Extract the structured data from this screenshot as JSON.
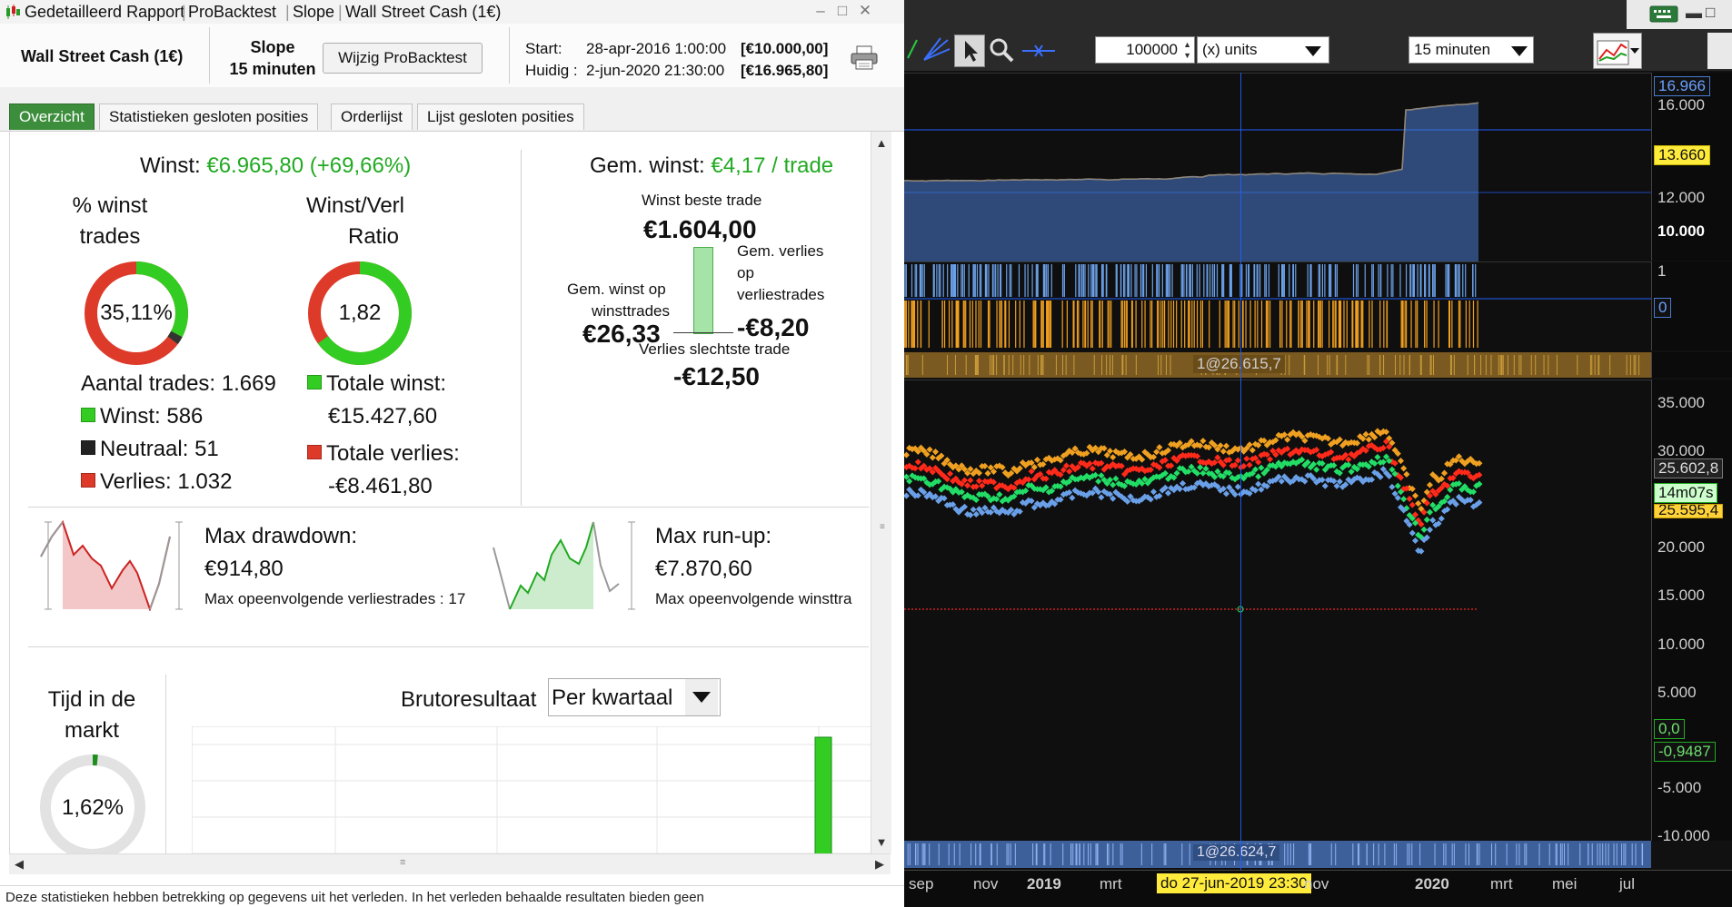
{
  "report": {
    "titlebar": {
      "items": [
        "Gedetailleerd Rapport",
        "ProBacktest",
        "Slope",
        "Wall Street Cash (1€)"
      ],
      "minimize": "–",
      "maximize": "□",
      "close": "✕"
    },
    "header": {
      "instrument": "Wall Street Cash (1€)",
      "strategy_name": "Slope",
      "timeframe": "15 minuten",
      "modify_button": "Wijzig ProBacktest",
      "start_label": "Start:",
      "start_date": "28-apr-2016 1:00:00",
      "start_value": "[€10.000,00]",
      "current_label": "Huidig :",
      "current_date": "2-jun-2020 21:30:00",
      "current_value": "[€16.965,80]"
    },
    "tabs": [
      "Overzicht",
      "Statistieken gesloten posities",
      "Orderlijst",
      "Lijst gesloten posities"
    ],
    "summary": {
      "profit_label": "Winst:",
      "profit_value": "€6.965,80 (+69,66%)",
      "pct_win_title_1": "% winst",
      "pct_win_title_2": "trades",
      "pct_win_value": "35,11%",
      "pct_win_fraction": 0.3511,
      "ratio_title_1": "Winst/Verl",
      "ratio_title_2": "Ratio",
      "ratio_value": "1,82",
      "num_trades_label": "Aantal trades:",
      "num_trades_value": "1.669",
      "win_label": "Winst:",
      "win_count": "586",
      "neutral_label": "Neutraal:",
      "neutral_count": "51",
      "loss_label": "Verlies:",
      "loss_count": "1.032",
      "total_win_label": "Totale winst:",
      "total_win_value": "€15.427,60",
      "total_loss_label": "Totale verlies:",
      "total_loss_value": "-€8.461,80"
    },
    "avg": {
      "label": "Gem. winst:",
      "value": "€4,17 / trade",
      "best_label": "Winst beste trade",
      "best_value": "€1.604,00",
      "avg_win_label_1": "Gem. winst op",
      "avg_win_label_2": "winsttrades",
      "avg_win_value": "€26,33",
      "avg_loss_label_1": "Gem. verlies",
      "avg_loss_label_2": "op",
      "avg_loss_label_3": "verliestrades",
      "avg_loss_value": "-€8,20",
      "worst_label": "Verlies slechtste trade",
      "worst_value": "-€12,50"
    },
    "drawdown": {
      "label": "Max drawdown:",
      "value": "€914,80",
      "consecutive": "Max opeenvolgende verliestrades : 17"
    },
    "runup": {
      "label": "Max run-up:",
      "value": "€7.870,60",
      "consecutive": "Max opeenvolgende winsttra"
    },
    "market_time": {
      "title_1": "Tijd in de",
      "title_2": "markt",
      "value": "1,62%",
      "fraction": 0.0162
    },
    "gross": {
      "label": "Brutoresultaat",
      "select_value": "Per kwartaal"
    },
    "footer": "Deze statistieken hebben betrekking op gegevens uit het verleden. In het verleden behaalde resultaten bieden geen"
  },
  "chart": {
    "toolbar": {
      "units_value": "100000",
      "units_label": "(x) units",
      "timeframe": "15 minuten"
    },
    "equity_axis": [
      "16.000",
      "12.000",
      "10.000"
    ],
    "equity_last": "16.966",
    "equity_cursor": "13.660",
    "position_axis": [
      "1",
      "0"
    ],
    "price_axis": [
      "35.000",
      "30.000",
      "20.000",
      "15.000",
      "10.000",
      "5.000",
      "-5.000",
      "-10.000"
    ],
    "price_last": "25.602,8",
    "price_timer": "14m07s",
    "price_second": "25.595,4",
    "osc_zero": "0,0",
    "osc_value": "-0,9487",
    "bar_label_top": "1@26.615,7",
    "bar_label_bottom": "1@26.624,7",
    "x_labels": [
      "sep",
      "nov",
      "2019",
      "mrt",
      "nov",
      "2020",
      "mrt",
      "mei",
      "jul"
    ],
    "cursor_date": "do 27-jun-2019 23:30",
    "colors": {
      "equity": "#4a7bd0",
      "orange": "#f0a020",
      "red": "#ff2a1a",
      "green": "#22dd66",
      "blue": "#6aa0e8",
      "cursor": "#1f5fff"
    }
  }
}
